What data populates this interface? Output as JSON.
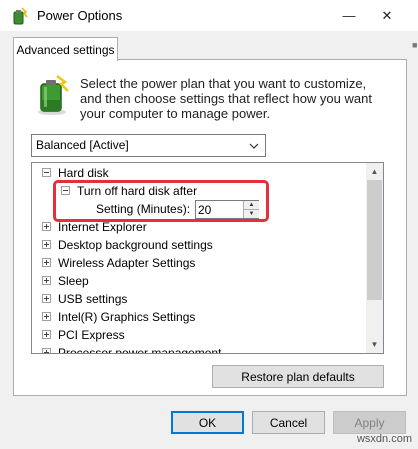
{
  "window": {
    "title": "Power Options",
    "controls": {
      "minimize": "—",
      "close": "✕"
    }
  },
  "tabs": [
    {
      "label": "Advanced settings",
      "active": true
    }
  ],
  "description": "Select the power plan that you want to customize, and then choose settings that reflect how you want your computer to manage power.",
  "plan_select": {
    "value": "Balanced [Active]"
  },
  "tree": {
    "items": [
      {
        "label": "Hard disk",
        "state": "expanded"
      },
      {
        "label": "Turn off hard disk after",
        "state": "expanded"
      },
      {
        "label": "Setting (Minutes):",
        "value": "20"
      },
      {
        "label": "Internet Explorer",
        "state": "collapsed"
      },
      {
        "label": "Desktop background settings",
        "state": "collapsed"
      },
      {
        "label": "Wireless Adapter Settings",
        "state": "collapsed"
      },
      {
        "label": "Sleep",
        "state": "collapsed"
      },
      {
        "label": "USB settings",
        "state": "collapsed"
      },
      {
        "label": "Intel(R) Graphics Settings",
        "state": "collapsed"
      },
      {
        "label": "PCI Express",
        "state": "collapsed"
      },
      {
        "label": "Processor power management",
        "state": "collapsed"
      }
    ]
  },
  "buttons": {
    "restore": "Restore plan defaults",
    "ok": "OK",
    "cancel": "Cancel",
    "apply": "Apply"
  },
  "colors": {
    "highlight": "#e3313c",
    "ok_border": "#0078d7"
  },
  "watermark": "wsxdn.com"
}
